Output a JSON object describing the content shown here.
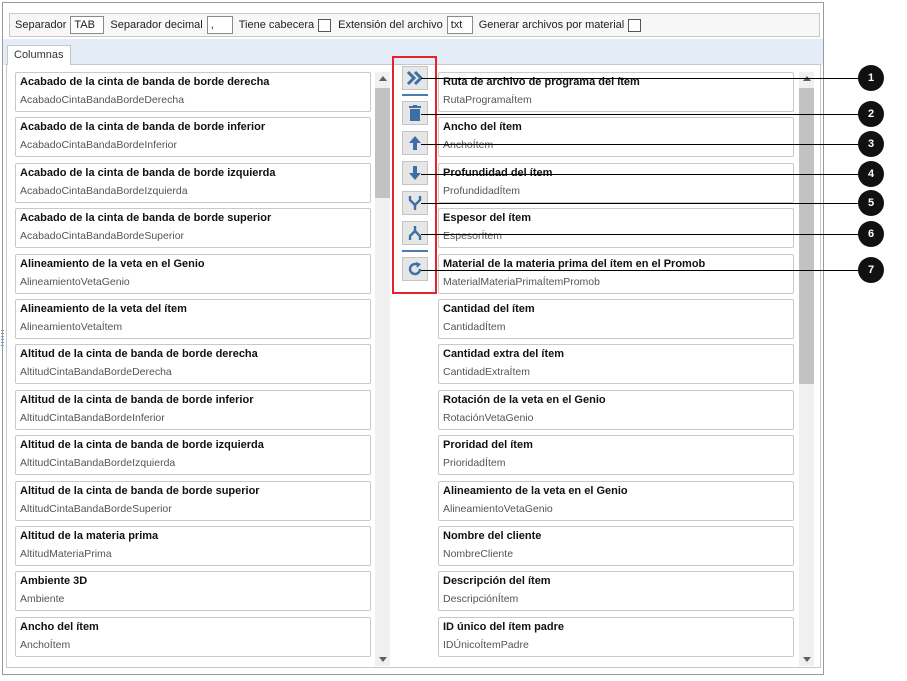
{
  "toolbar": {
    "separator_label": "Separador",
    "separator_value": "TAB",
    "decimal_label": "Separador decimal",
    "decimal_value": ",",
    "header_label": "Tiene cabecera",
    "extension_label": "Extensión del archivo",
    "extension_value": "txt",
    "per_material_label": "Generar archivos por material"
  },
  "tab_label": "Columnas",
  "left_list": [
    {
      "title": "Acabado de la cinta de banda de borde derecha",
      "sub": "AcabadoCintaBandaBordeDerecha"
    },
    {
      "title": "Acabado de la cinta de banda de borde inferior",
      "sub": "AcabadoCintaBandaBordeInferior"
    },
    {
      "title": "Acabado de la cinta de banda de borde izquierda",
      "sub": "AcabadoCintaBandaBordeIzquierda"
    },
    {
      "title": "Acabado de la cinta de banda de borde superior",
      "sub": "AcabadoCintaBandaBordeSuperior"
    },
    {
      "title": "Alineamiento de la veta en el Genio",
      "sub": "AlineamientoVetaGenio"
    },
    {
      "title": "Alineamiento de la veta del ítem",
      "sub": "AlineamientoVetaÍtem"
    },
    {
      "title": "Altitud de la cinta de banda de borde derecha",
      "sub": "AltitudCintaBandaBordeDerecha"
    },
    {
      "title": "Altitud de la cinta de banda de borde inferior",
      "sub": "AltitudCintaBandaBordeInferior"
    },
    {
      "title": "Altitud de la cinta de banda de borde izquierda",
      "sub": "AltitudCintaBandaBordeIzquierda"
    },
    {
      "title": "Altitud de la cinta de banda de borde superior",
      "sub": "AltitudCintaBandaBordeSuperior"
    },
    {
      "title": "Altitud de la materia prima",
      "sub": "AltitudMateriaPrima"
    },
    {
      "title": "Ambiente 3D",
      "sub": "Ambiente"
    },
    {
      "title": "Ancho del ítem",
      "sub": "AnchoÍtem"
    }
  ],
  "right_list": [
    {
      "title": "Ruta de archivo de programa del ítem",
      "sub": "RutaProgramaÍtem"
    },
    {
      "title": "Ancho del ítem",
      "sub": "AnchoÍtem"
    },
    {
      "title": "Profundidad del ítem",
      "sub": "ProfundidadÍtem"
    },
    {
      "title": "Espesor del ítem",
      "sub": "EspesorÍtem"
    },
    {
      "title": "Material de la materia prima del ítem en el Promob",
      "sub": "MaterialMateriaPrimaÍtemPromob"
    },
    {
      "title": "Cantidad del ítem",
      "sub": "CantidadÍtem"
    },
    {
      "title": "Cantidad extra del ítem",
      "sub": "CantidadExtraÍtem"
    },
    {
      "title": "Rotación de la veta en el Genio",
      "sub": "RotaciónVetaGenio"
    },
    {
      "title": "Proridad del ítem",
      "sub": "PrioridadÍtem"
    },
    {
      "title": "Alineamiento de la veta en el Genio",
      "sub": "AlineamientoVetaGenio"
    },
    {
      "title": "Nombre del cliente",
      "sub": "NombreCliente"
    },
    {
      "title": "Descripción del ítem",
      "sub": "DescripciónÍtem"
    },
    {
      "title": "ID único del ítem padre",
      "sub": "IDÚnicoÍtemPadre"
    }
  ],
  "callouts": [
    "1",
    "2",
    "3",
    "4",
    "5",
    "6",
    "7"
  ],
  "icons": {
    "add": "double-chevron-right-icon",
    "delete": "trash-icon",
    "up": "arrow-up-icon",
    "down": "arrow-down-icon",
    "merge": "merge-icon",
    "split": "split-icon",
    "reset": "refresh-icon"
  },
  "colors": {
    "accent": "#4a7cb0",
    "highlight": "#e0252b"
  }
}
